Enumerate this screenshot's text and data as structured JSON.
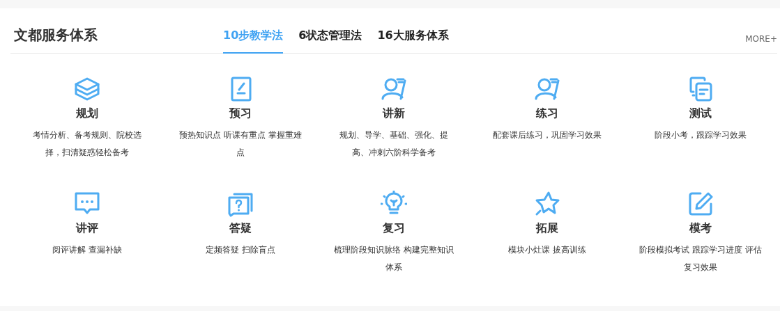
{
  "title": "文都服务体系",
  "tabs": [
    {
      "label": "10步教学法",
      "selected": true
    },
    {
      "label": "6状态管理法",
      "selected": false
    },
    {
      "label": "16大服务体系",
      "selected": false
    }
  ],
  "more_link": "MORE+",
  "items": [
    {
      "title": "规划",
      "description": [
        "考情分析、备考规则、院校选",
        "择，扫清疑惑轻松备考"
      ]
    },
    {
      "title": "预习",
      "description": [
        "预热知识点 听课有重点 掌握重难",
        "点"
      ]
    },
    {
      "title": "讲新",
      "description": [
        "规划、导学、基础、强化、提",
        "高、冲刺六阶科学备考"
      ]
    },
    {
      "title": "练习",
      "description": [
        "配套课后练习，巩固学习效果"
      ]
    },
    {
      "title": "测试",
      "description": [
        "阶段小考，跟踪学习效果"
      ]
    },
    {
      "title": "讲评",
      "description": [
        "阅评讲解 查漏补缺"
      ]
    },
    {
      "title": "答疑",
      "description": [
        "定频答疑 扫除盲点"
      ]
    },
    {
      "title": "复习",
      "description": [
        "梳理阶段知识脉络 构建完整知识",
        "体系"
      ]
    },
    {
      "title": "拓展",
      "description": [
        "模块小灶课 拔高训练"
      ]
    },
    {
      "title": "模考",
      "description": [
        "阶段模拟考试 跟踪学习进度 评估",
        "复习效果"
      ]
    }
  ]
}
